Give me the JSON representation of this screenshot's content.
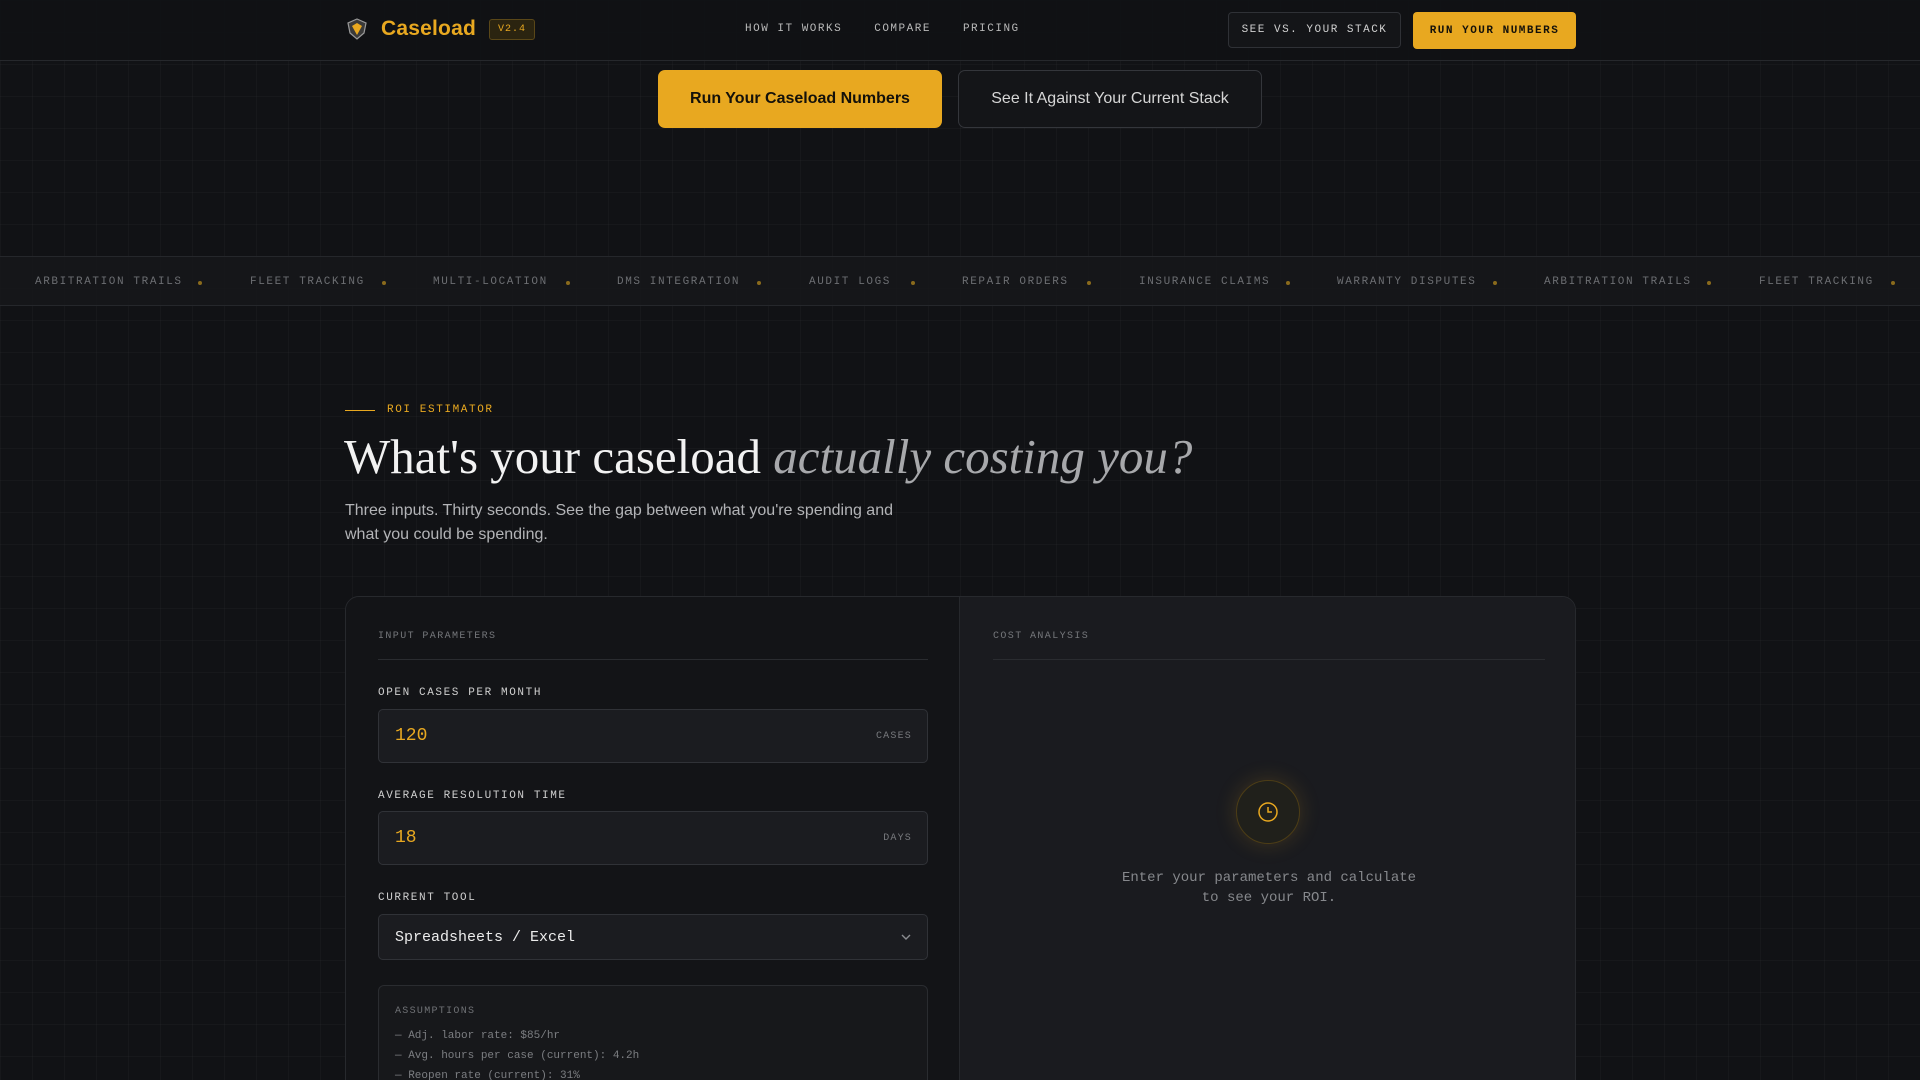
{
  "nav": {
    "brand": "Caseload",
    "version": "V2.4",
    "links": [
      "HOW IT WORKS",
      "COMPARE",
      "PRICING"
    ],
    "compare_button": "SEE VS. YOUR STACK",
    "cta_button": "RUN YOUR NUMBERS"
  },
  "hero": {
    "primary_button": "Run Your Caseload Numbers",
    "secondary_button": "See It Against Your Current Stack"
  },
  "ticker": {
    "items": [
      "ARBITRATION TRAILS",
      "FLEET TRACKING",
      "MULTI-LOCATION",
      "DMS INTEGRATION",
      "AUDIT LOGS",
      "REPAIR ORDERS",
      "INSURANCE CLAIMS",
      "WARRANTY DISPUTES",
      "ARBITRATION TRAILS",
      "FLEET TRACKING"
    ]
  },
  "section": {
    "eyebrow": "ROI ESTIMATOR",
    "headline_plain": "What's your caseload",
    "headline_italic": "actually costing you?",
    "subtext": "Three inputs. Thirty seconds. See the gap between what you're spending and what you could be spending."
  },
  "inputs": {
    "panel_title": "INPUT PARAMETERS",
    "cases_label": "OPEN CASES PER MONTH",
    "cases_value": "120",
    "cases_unit": "CASES",
    "resolution_label": "AVERAGE RESOLUTION TIME",
    "resolution_value": "18",
    "resolution_unit": "DAYS",
    "tool_label": "CURRENT TOOL",
    "tool_value": "Spreadsheets / Excel"
  },
  "assumptions": {
    "title": "ASSUMPTIONS",
    "lines": [
      "— Adj. labor rate: $85/hr",
      "— Avg. hours per case (current): 4.2h",
      "— Reopen rate (current): 31%"
    ]
  },
  "analysis": {
    "panel_title": "COST ANALYSIS",
    "empty_text": "Enter your parameters and calculate to see your ROI."
  },
  "colors": {
    "accent": "#e8a820",
    "background": "#111215"
  }
}
